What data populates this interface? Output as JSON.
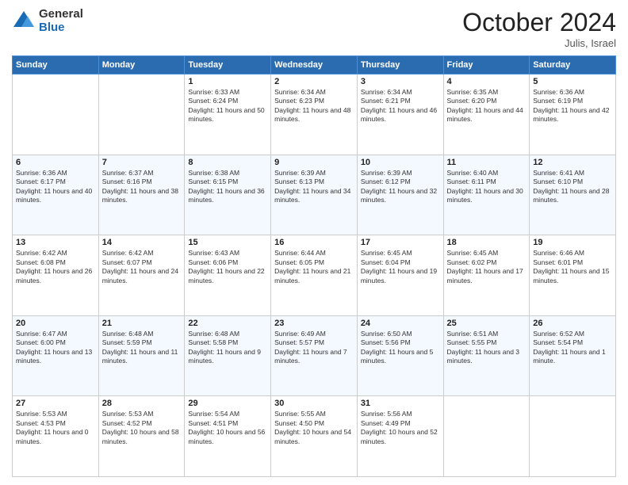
{
  "header": {
    "logo": {
      "general": "General",
      "blue": "Blue"
    },
    "month": "October 2024",
    "location": "Julis, Israel"
  },
  "weekdays": [
    "Sunday",
    "Monday",
    "Tuesday",
    "Wednesday",
    "Thursday",
    "Friday",
    "Saturday"
  ],
  "weeks": [
    [
      {
        "day": "",
        "info": ""
      },
      {
        "day": "",
        "info": ""
      },
      {
        "day": "1",
        "info": "Sunrise: 6:33 AM\nSunset: 6:24 PM\nDaylight: 11 hours and 50 minutes."
      },
      {
        "day": "2",
        "info": "Sunrise: 6:34 AM\nSunset: 6:23 PM\nDaylight: 11 hours and 48 minutes."
      },
      {
        "day": "3",
        "info": "Sunrise: 6:34 AM\nSunset: 6:21 PM\nDaylight: 11 hours and 46 minutes."
      },
      {
        "day": "4",
        "info": "Sunrise: 6:35 AM\nSunset: 6:20 PM\nDaylight: 11 hours and 44 minutes."
      },
      {
        "day": "5",
        "info": "Sunrise: 6:36 AM\nSunset: 6:19 PM\nDaylight: 11 hours and 42 minutes."
      }
    ],
    [
      {
        "day": "6",
        "info": "Sunrise: 6:36 AM\nSunset: 6:17 PM\nDaylight: 11 hours and 40 minutes."
      },
      {
        "day": "7",
        "info": "Sunrise: 6:37 AM\nSunset: 6:16 PM\nDaylight: 11 hours and 38 minutes."
      },
      {
        "day": "8",
        "info": "Sunrise: 6:38 AM\nSunset: 6:15 PM\nDaylight: 11 hours and 36 minutes."
      },
      {
        "day": "9",
        "info": "Sunrise: 6:39 AM\nSunset: 6:13 PM\nDaylight: 11 hours and 34 minutes."
      },
      {
        "day": "10",
        "info": "Sunrise: 6:39 AM\nSunset: 6:12 PM\nDaylight: 11 hours and 32 minutes."
      },
      {
        "day": "11",
        "info": "Sunrise: 6:40 AM\nSunset: 6:11 PM\nDaylight: 11 hours and 30 minutes."
      },
      {
        "day": "12",
        "info": "Sunrise: 6:41 AM\nSunset: 6:10 PM\nDaylight: 11 hours and 28 minutes."
      }
    ],
    [
      {
        "day": "13",
        "info": "Sunrise: 6:42 AM\nSunset: 6:08 PM\nDaylight: 11 hours and 26 minutes."
      },
      {
        "day": "14",
        "info": "Sunrise: 6:42 AM\nSunset: 6:07 PM\nDaylight: 11 hours and 24 minutes."
      },
      {
        "day": "15",
        "info": "Sunrise: 6:43 AM\nSunset: 6:06 PM\nDaylight: 11 hours and 22 minutes."
      },
      {
        "day": "16",
        "info": "Sunrise: 6:44 AM\nSunset: 6:05 PM\nDaylight: 11 hours and 21 minutes."
      },
      {
        "day": "17",
        "info": "Sunrise: 6:45 AM\nSunset: 6:04 PM\nDaylight: 11 hours and 19 minutes."
      },
      {
        "day": "18",
        "info": "Sunrise: 6:45 AM\nSunset: 6:02 PM\nDaylight: 11 hours and 17 minutes."
      },
      {
        "day": "19",
        "info": "Sunrise: 6:46 AM\nSunset: 6:01 PM\nDaylight: 11 hours and 15 minutes."
      }
    ],
    [
      {
        "day": "20",
        "info": "Sunrise: 6:47 AM\nSunset: 6:00 PM\nDaylight: 11 hours and 13 minutes."
      },
      {
        "day": "21",
        "info": "Sunrise: 6:48 AM\nSunset: 5:59 PM\nDaylight: 11 hours and 11 minutes."
      },
      {
        "day": "22",
        "info": "Sunrise: 6:48 AM\nSunset: 5:58 PM\nDaylight: 11 hours and 9 minutes."
      },
      {
        "day": "23",
        "info": "Sunrise: 6:49 AM\nSunset: 5:57 PM\nDaylight: 11 hours and 7 minutes."
      },
      {
        "day": "24",
        "info": "Sunrise: 6:50 AM\nSunset: 5:56 PM\nDaylight: 11 hours and 5 minutes."
      },
      {
        "day": "25",
        "info": "Sunrise: 6:51 AM\nSunset: 5:55 PM\nDaylight: 11 hours and 3 minutes."
      },
      {
        "day": "26",
        "info": "Sunrise: 6:52 AM\nSunset: 5:54 PM\nDaylight: 11 hours and 1 minute."
      }
    ],
    [
      {
        "day": "27",
        "info": "Sunrise: 5:53 AM\nSunset: 4:53 PM\nDaylight: 11 hours and 0 minutes."
      },
      {
        "day": "28",
        "info": "Sunrise: 5:53 AM\nSunset: 4:52 PM\nDaylight: 10 hours and 58 minutes."
      },
      {
        "day": "29",
        "info": "Sunrise: 5:54 AM\nSunset: 4:51 PM\nDaylight: 10 hours and 56 minutes."
      },
      {
        "day": "30",
        "info": "Sunrise: 5:55 AM\nSunset: 4:50 PM\nDaylight: 10 hours and 54 minutes."
      },
      {
        "day": "31",
        "info": "Sunrise: 5:56 AM\nSunset: 4:49 PM\nDaylight: 10 hours and 52 minutes."
      },
      {
        "day": "",
        "info": ""
      },
      {
        "day": "",
        "info": ""
      }
    ]
  ]
}
